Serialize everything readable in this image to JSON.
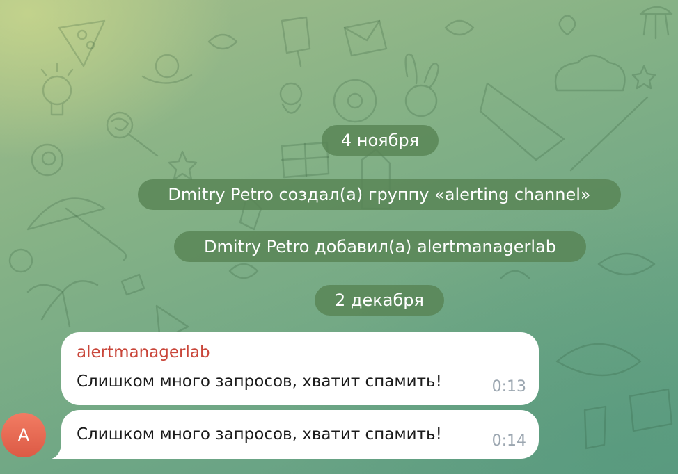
{
  "chat": {
    "service_messages": [
      {
        "text": "4 ноября"
      },
      {
        "text": "Dmitry Petro создал(а) группу «alerting channel»"
      },
      {
        "text": "Dmitry Petro добавил(а) alertmanagerlab"
      },
      {
        "text": "2 декабря"
      }
    ],
    "messages": [
      {
        "sender": "alertmanagerlab",
        "text": "Слишком много запросов, хватит спамить!",
        "time": "0:13"
      },
      {
        "text": "Слишком много запросов, хватит спамить!",
        "time": "0:14"
      }
    ],
    "avatar": {
      "initial": "A",
      "color": "#e06650"
    }
  },
  "colors": {
    "sender_name": "#c9463a",
    "time": "#9ba6b0",
    "service_pill": "#588454"
  },
  "icons": {
    "background": "telegram-doodle-pattern"
  }
}
